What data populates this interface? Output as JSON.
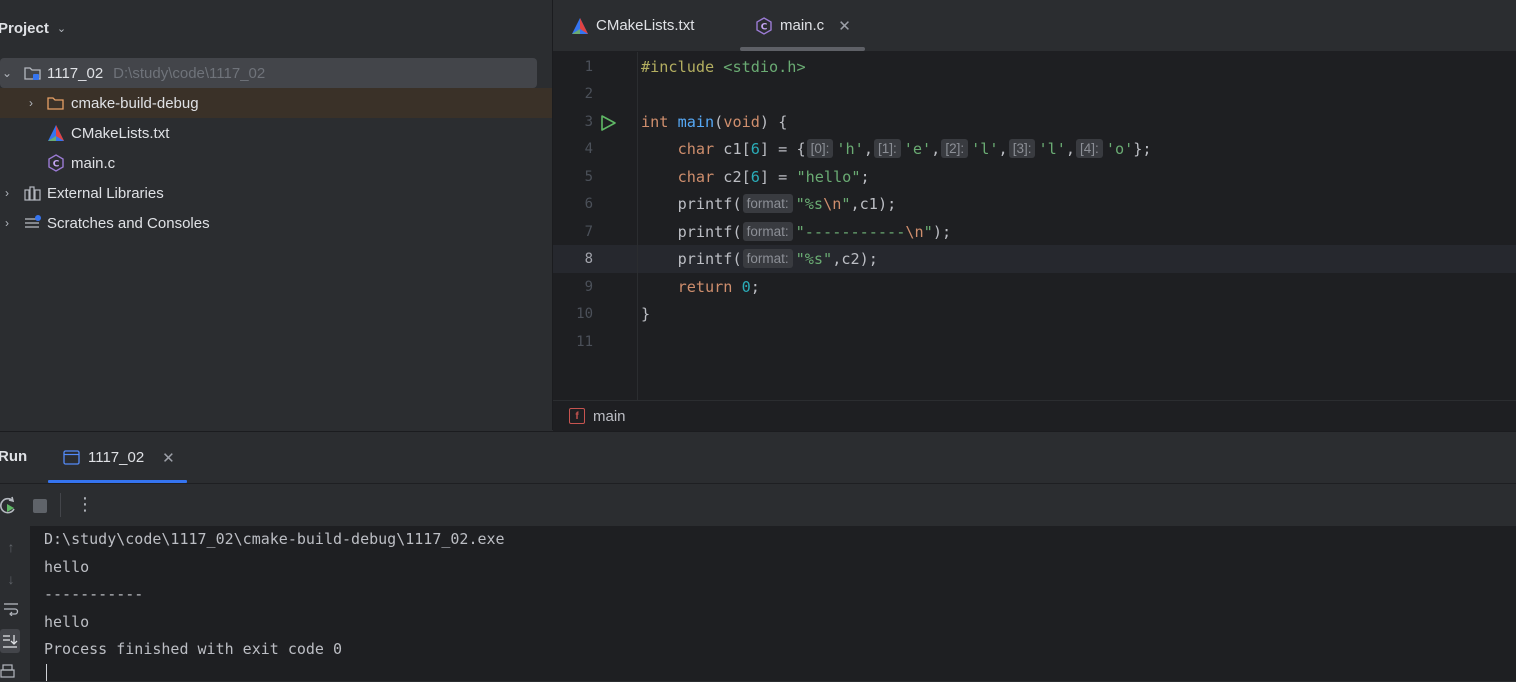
{
  "project": {
    "title": "Project",
    "root": {
      "name": "1117_02",
      "path": "D:\\study\\code\\1117_02"
    },
    "items": [
      {
        "label": "cmake-build-debug"
      },
      {
        "label": "CMakeLists.txt"
      },
      {
        "label": "main.c"
      },
      {
        "label": "External Libraries"
      },
      {
        "label": "Scratches and Consoles"
      }
    ]
  },
  "editor": {
    "tabs": [
      {
        "label": "CMakeLists.txt",
        "active": false
      },
      {
        "label": "main.c",
        "active": true
      }
    ],
    "line_numbers": [
      "1",
      "2",
      "3",
      "4",
      "5",
      "6",
      "7",
      "8",
      "9",
      "10",
      "11"
    ],
    "current_line": "8",
    "code": {
      "l1_directive": "#include",
      "l1_header": " <stdio.h>",
      "l3_int": "int",
      "l3_main": "main",
      "l3_void": "void",
      "l4_char": "char",
      "l4_name": " c1[",
      "l4_size": "6",
      "l4_rest": "] = {",
      "l4_h0": "[0]:",
      "l4_v0": "'h'",
      "l4_h1": "[1]:",
      "l4_v1": "'e'",
      "l4_h2": "[2]:",
      "l4_v2": "'l'",
      "l4_h3": "[3]:",
      "l4_v3": "'l'",
      "l4_h4": "[4]:",
      "l4_v4": "'o'",
      "l5_char": "char",
      "l5_name": " c2[",
      "l5_size": "6",
      "l5_rest": "] = ",
      "l5_str": "\"hello\"",
      "printf": "printf",
      "hint_format": "format:",
      "l6_str": "\"%s",
      "l6_esc": "\\n",
      "l6_end": "\"",
      "l6_arg": ",c1);",
      "l7_str": "\"-----------",
      "l7_esc": "\\n",
      "l7_end": "\"",
      "l7_arg": ");",
      "l8_str": "\"%s\"",
      "l8_arg": ",c2);",
      "l9_return": "return",
      "l9_zero": "0",
      "l9_semi": ";",
      "l10_brace": "}"
    },
    "breadcrumb": "main"
  },
  "run": {
    "title": "Run",
    "tab_label": "1117_02",
    "console_lines": [
      "D:\\study\\code\\1117_02\\cmake-build-debug\\1117_02.exe",
      "hello",
      "-----------",
      "hello",
      "Process finished with exit code 0"
    ]
  },
  "colors": {
    "accent": "#3574f0",
    "keyword": "#cf8e6d",
    "string": "#6aab73",
    "function": "#56a8f5",
    "number": "#2aacb8"
  }
}
